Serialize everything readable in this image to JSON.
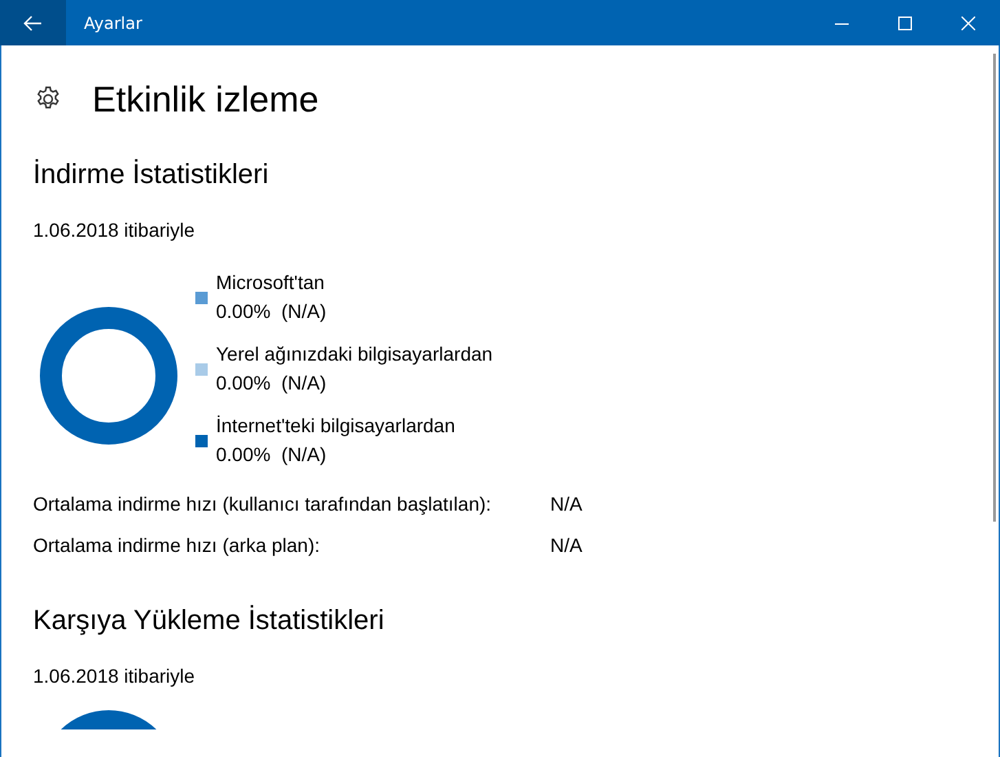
{
  "window": {
    "title": "Ayarlar"
  },
  "page": {
    "title": "Etkinlik izleme"
  },
  "download": {
    "heading": "İndirme İstatistikleri",
    "date": "1.06.2018 itibariyle",
    "legend": [
      {
        "label": "Microsoft'tan",
        "value": "0.00%  (N/A)",
        "color": "#5a9bd4"
      },
      {
        "label": "Yerel ağınızdaki bilgisayarlardan",
        "value": "0.00%  (N/A)",
        "color": "#a9cbe8"
      },
      {
        "label": "İnternet'teki bilgisayarlardan",
        "value": "0.00%  (N/A)",
        "color": "#0063b1"
      }
    ],
    "stats": [
      {
        "label": "Ortalama indirme hızı (kullanıcı tarafından başlatılan):",
        "value": "N/A"
      },
      {
        "label": "Ortalama indirme hızı (arka plan):",
        "value": "N/A"
      }
    ]
  },
  "upload": {
    "heading": "Karşıya Yükleme İstatistikleri",
    "date": "1.06.2018 itibariyle"
  }
}
